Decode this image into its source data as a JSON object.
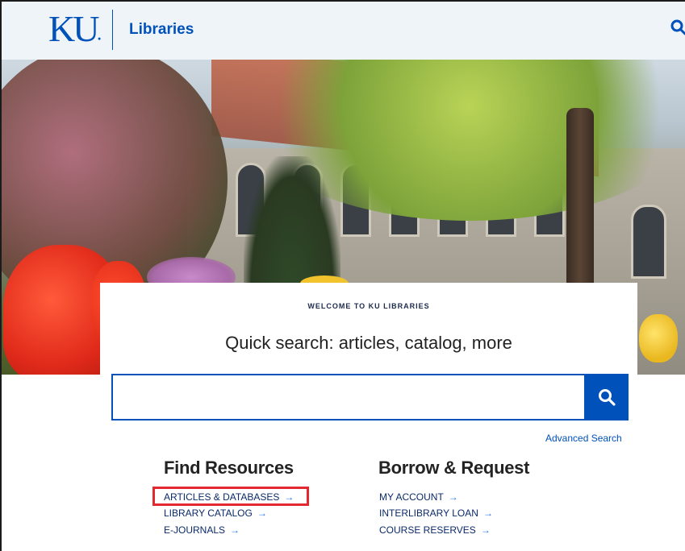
{
  "header": {
    "logo_text": "KU",
    "site_name": "Libraries",
    "search_icon": "search-icon"
  },
  "hero": {
    "image_description_icon": "campus-photo"
  },
  "search": {
    "eyebrow": "WELCOME TO KU LIBRARIES",
    "heading": "Quick search: articles, catalog, more",
    "input_value": "",
    "button_icon": "search-icon",
    "advanced_link": "Advanced Search"
  },
  "find_resources": {
    "title": "Find Resources",
    "links": [
      {
        "label": "ARTICLES & DATABASES",
        "arrow": "→"
      },
      {
        "label": "LIBRARY CATALOG",
        "arrow": "→"
      },
      {
        "label": "E-JOURNALS",
        "arrow": "→"
      }
    ]
  },
  "borrow_request": {
    "title": "Borrow & Request",
    "links": [
      {
        "label": "MY ACCOUNT",
        "arrow": "→"
      },
      {
        "label": "INTERLIBRARY LOAN",
        "arrow": "→"
      },
      {
        "label": "COURSE RESERVES",
        "arrow": "→"
      }
    ]
  },
  "colors": {
    "brand_blue": "#0051ba",
    "header_bg": "#eef4f7",
    "highlight_red": "#e3282f",
    "arrow_blue": "#1f6ff2"
  }
}
